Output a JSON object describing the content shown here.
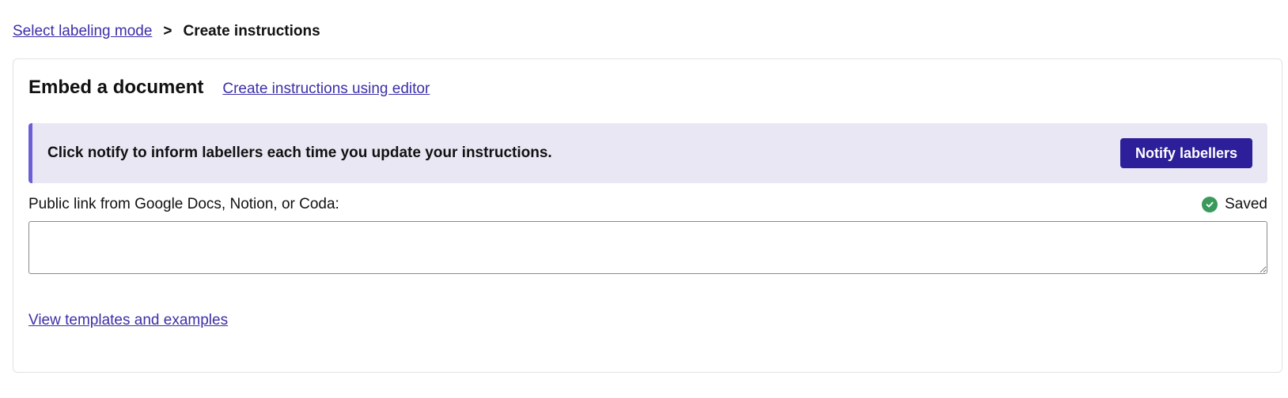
{
  "breadcrumb": {
    "parent_label": "Select labeling mode",
    "separator": ">",
    "current_label": "Create instructions"
  },
  "card": {
    "title": "Embed a document",
    "editor_link": "Create instructions using editor",
    "notice": {
      "text": "Click notify to inform labellers each time you update your instructions.",
      "button_label": "Notify labellers"
    },
    "field": {
      "label": "Public link from Google Docs, Notion, or Coda:",
      "value": "",
      "status": "Saved",
      "status_icon": "check-circle-icon"
    },
    "templates_link": "View templates and examples"
  },
  "colors": {
    "accent": "#2d1f99",
    "link": "#3b2fa8",
    "notice_bg": "#e9e7f3",
    "notice_border": "#6b5fd6",
    "success": "#3a9a5c"
  }
}
